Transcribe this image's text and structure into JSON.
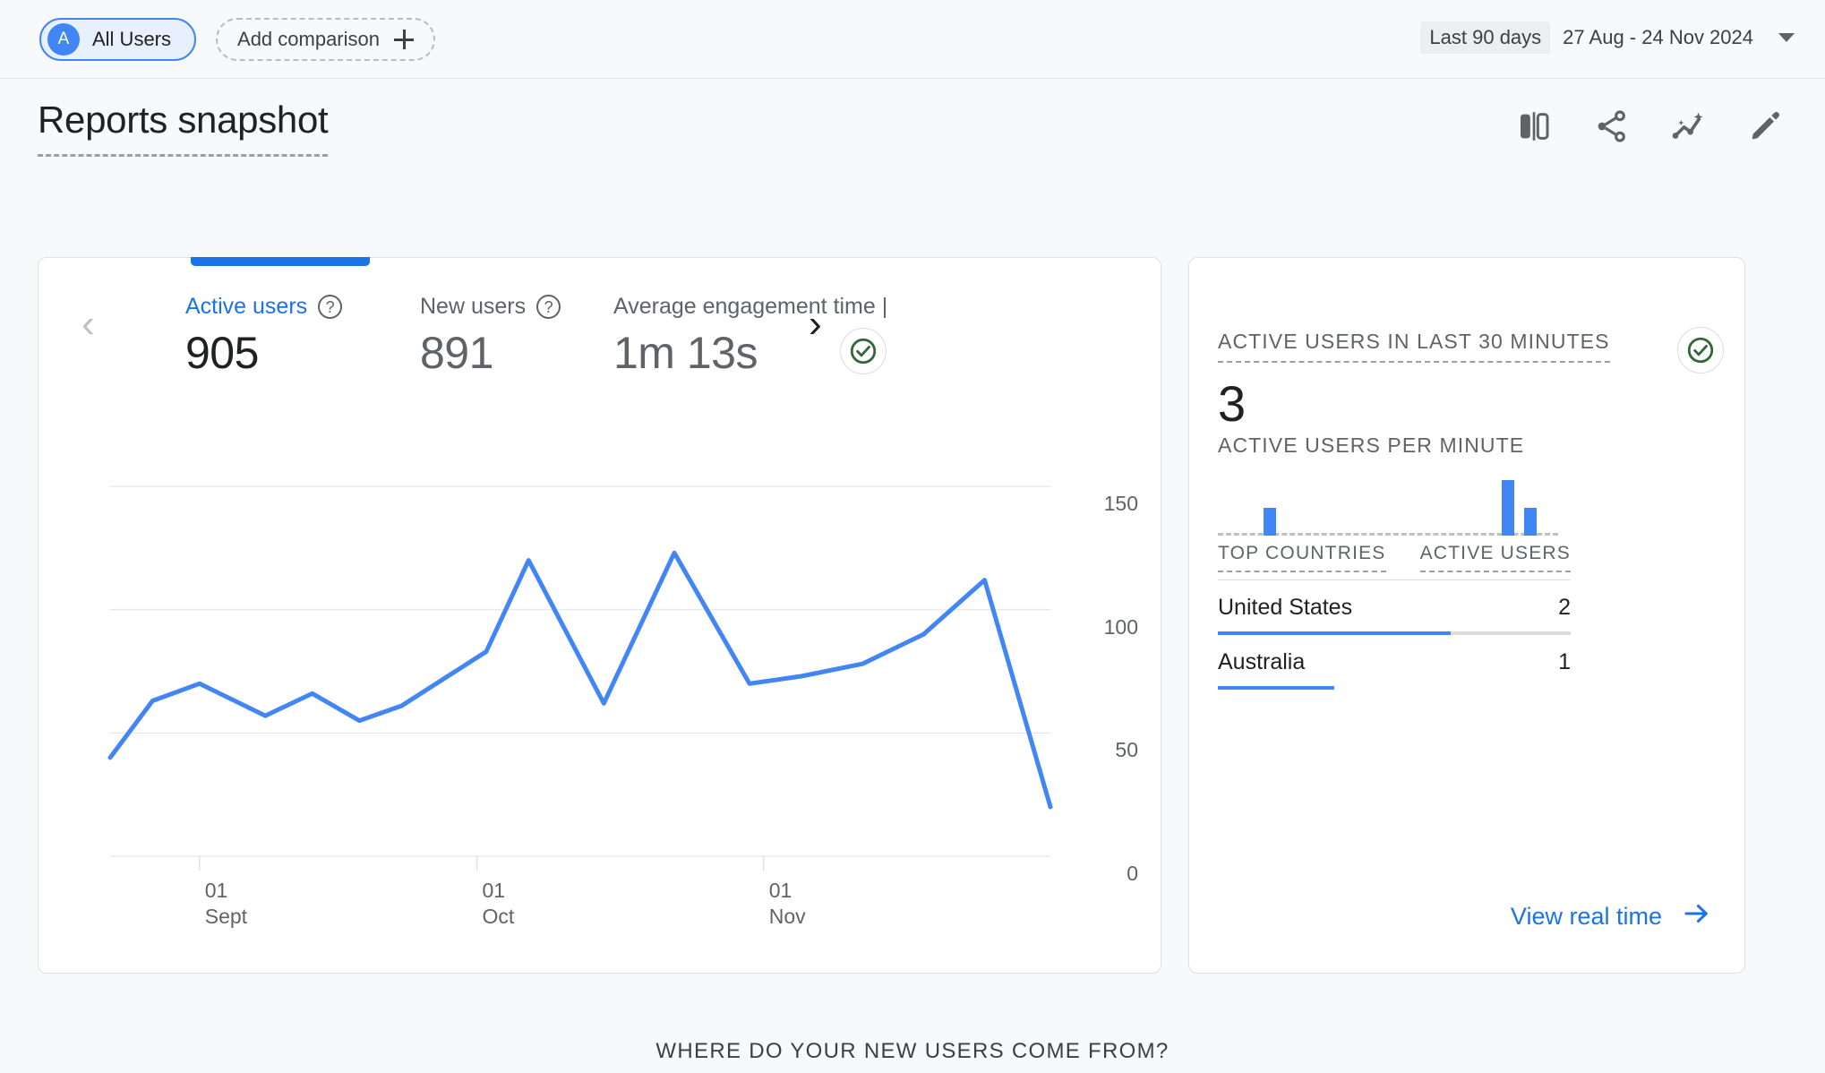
{
  "topbar": {
    "audience_chip": {
      "initial": "A",
      "label": "All Users"
    },
    "add_comparison": {
      "label": "Add comparison",
      "icon": "plus-icon"
    },
    "date_range": {
      "preset": "Last 90 days",
      "dates": "27 Aug - 24 Nov 2024"
    }
  },
  "header": {
    "title": "Reports snapshot",
    "tools": [
      {
        "name": "compare-view-icon",
        "tooltip": "Compare"
      },
      {
        "name": "share-icon",
        "tooltip": "Share this report"
      },
      {
        "name": "insights-icon",
        "tooltip": "Insights"
      },
      {
        "name": "edit-pencil-icon",
        "tooltip": "Customise report"
      }
    ]
  },
  "overview_card": {
    "metrics": [
      {
        "label": "Active users",
        "value": "905",
        "selected": true,
        "help": "?"
      },
      {
        "label": "New users",
        "value": "891",
        "selected": false,
        "help": "?"
      },
      {
        "label": "Average engagement time |",
        "value": "1m 13s",
        "selected": false,
        "help": ""
      }
    ],
    "prev_label": "‹",
    "next_label": "›",
    "status_icon": "check-circle-icon"
  },
  "realtime_card": {
    "heading": "ACTIVE USERS IN LAST 30 MINUTES",
    "value": "3",
    "per_minute_label": "ACTIVE USERS PER MINUTE",
    "status_icon": "check-circle-icon",
    "table": {
      "col_country": "TOP COUNTRIES",
      "col_users": "ACTIVE USERS",
      "rows": [
        {
          "country": "United States",
          "users": "2",
          "bar_pct": 66,
          "track": true
        },
        {
          "country": "Australia",
          "users": "1",
          "bar_pct": 33,
          "track": false
        }
      ]
    },
    "link": {
      "label": "View real time",
      "icon": "arrow-right-icon"
    }
  },
  "bottom": {
    "heading": "WHERE DO YOUR NEW USERS COME FROM?"
  },
  "colors": {
    "accent_blue": "#4285f4",
    "link_blue": "#1a73e8",
    "page_bg": "#f8f9fa",
    "card_bg": "#ffffff",
    "text_primary": "#202124",
    "text_secondary": "#5f6368",
    "status_green": "#34663b"
  },
  "chart_data": {
    "type": "line",
    "title": "Active users",
    "xlabel": "",
    "ylabel": "",
    "ylim": [
      0,
      150
    ],
    "yticks": [
      0,
      50,
      100,
      150
    ],
    "grid": true,
    "xticks": [
      {
        "day": "01",
        "month": "Sept",
        "pos": 0.095
      },
      {
        "day": "01",
        "month": "Oct",
        "pos": 0.39
      },
      {
        "day": "01",
        "month": "Nov",
        "pos": 0.695
      }
    ],
    "series": [
      {
        "name": "Active users",
        "color": "#4285f4",
        "x": [
          0.0,
          0.045,
          0.095,
          0.165,
          0.215,
          0.265,
          0.31,
          0.4,
          0.445,
          0.525,
          0.6,
          0.68,
          0.735,
          0.8,
          0.865,
          0.93,
          1.0
        ],
        "values": [
          40,
          63,
          70,
          57,
          66,
          55,
          61,
          83,
          120,
          62,
          123,
          70,
          73,
          78,
          90,
          112,
          20
        ]
      }
    ],
    "realtime_bars": {
      "type": "bar",
      "title": "ACTIVE USERS PER MINUTE",
      "values": [
        0,
        0,
        0,
        0,
        1,
        0,
        0,
        0,
        0,
        0,
        0,
        0,
        0,
        0,
        0,
        0,
        0,
        0,
        0,
        0,
        0,
        0,
        0,
        0,
        0,
        2,
        0,
        1,
        0,
        0
      ],
      "max": 2,
      "color": "#4285f4"
    }
  }
}
